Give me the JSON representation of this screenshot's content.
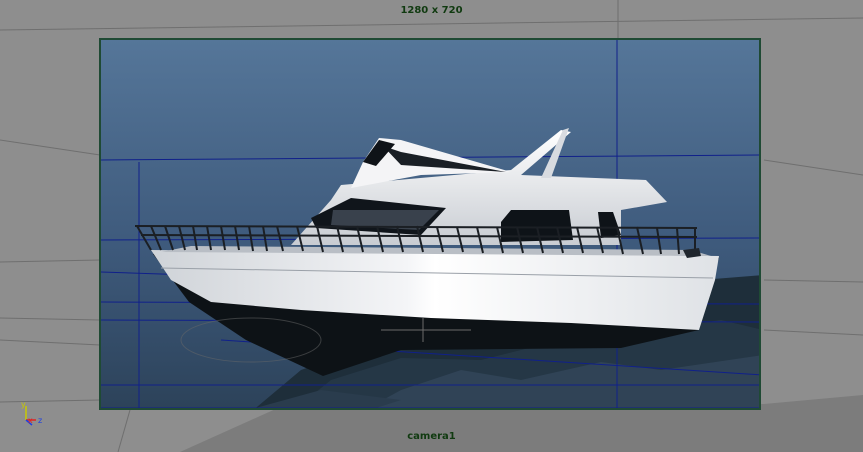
{
  "viewport": {
    "resolution_label": "1280 x 720",
    "camera_label": "camera1"
  },
  "axis_indicator": {
    "y_label": "y",
    "x_label": "x",
    "z_label": "z",
    "colors": {
      "y": "#c8c800",
      "x": "#e02020",
      "z": "#2040e0"
    }
  },
  "colors": {
    "viewport_grey": "#8e8e8e",
    "gate_border": "#1f4a34",
    "label_green": "#103a10",
    "sky_top": "#4e6f92",
    "sky_bottom": "#2f4761",
    "wireframe_blue": "#10208a"
  }
}
